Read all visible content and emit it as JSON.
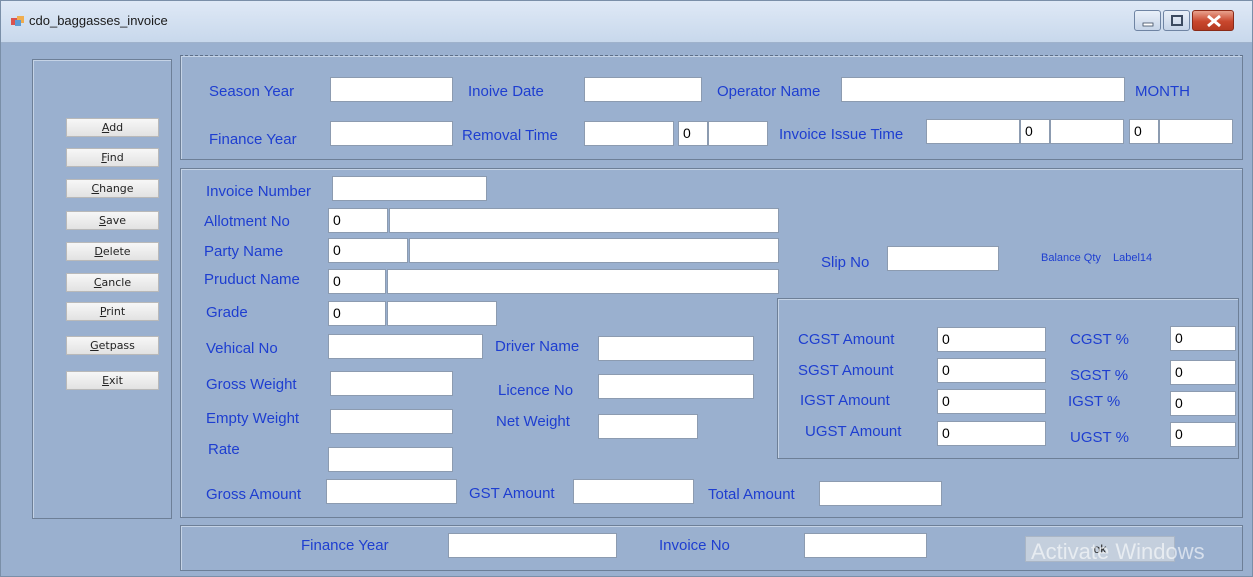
{
  "window": {
    "title": "cdo_baggasses_invoice"
  },
  "sidebar": {
    "buttons": [
      {
        "key": "add",
        "label": "Add",
        "mnemonic": "A"
      },
      {
        "key": "find",
        "label": "Find",
        "mnemonic": "F"
      },
      {
        "key": "change",
        "label": "Change",
        "mnemonic": "C"
      },
      {
        "key": "save",
        "label": "Save",
        "mnemonic": "S"
      },
      {
        "key": "delete",
        "label": "Delete",
        "mnemonic": "D"
      },
      {
        "key": "cancle",
        "label": "Cancle",
        "mnemonic": "C"
      },
      {
        "key": "print",
        "label": "Print",
        "mnemonic": "P"
      },
      {
        "key": "getpass",
        "label": "Getpass",
        "mnemonic": "G"
      },
      {
        "key": "exit",
        "label": "Exit",
        "mnemonic": "E"
      }
    ]
  },
  "header": {
    "season_year_label": "Season Year",
    "season_year_value": "",
    "invoice_date_label": "Inoive Date",
    "invoice_date_value": "",
    "operator_name_label": "Operator Name",
    "operator_name_value": "",
    "month_label": "MONTH",
    "finance_year_label": "Finance Year",
    "finance_year_value": "",
    "removal_time_label": "Removal Time",
    "removal_time_value": "",
    "removal_time_num": "0",
    "removal_time_extra": "",
    "invoice_issue_time_label": "Invoice Issue Time",
    "invoice_issue_time_value": "",
    "invoice_issue_num1": "0",
    "invoice_issue_extra1": "",
    "invoice_issue_num2": "0",
    "invoice_issue_extra2": ""
  },
  "details": {
    "invoice_number_label": "Invoice Number",
    "invoice_number_value": "",
    "allotment_no_label": "Allotment No",
    "allotment_no_code": "0",
    "allotment_no_value": "",
    "party_name_label": "Party Name",
    "party_name_code": "0",
    "party_name_value": "",
    "product_name_label": "Pruduct Name",
    "product_name_code": "0",
    "product_name_value": "",
    "grade_label": "Grade",
    "grade_code": "0",
    "grade_value": "",
    "vehical_no_label": "Vehical No",
    "vehical_no_value": "",
    "driver_name_label": "Driver Name",
    "driver_name_value": "",
    "gross_weight_label": "Gross Weight",
    "gross_weight_value": "",
    "licence_no_label": "Licence  No",
    "licence_no_value": "",
    "empty_weight_label": "Empty Weight",
    "empty_weight_value": "",
    "net_weight_label": "Net Weight",
    "net_weight_value": "",
    "rate_label": "Rate",
    "rate_value": "",
    "gross_amount_label": "Gross Amount",
    "gross_amount_value": "",
    "gst_amount_label": "GST Amount",
    "gst_amount_value": "",
    "total_amount_label": "Total Amount",
    "total_amount_value": "",
    "slip_no_label": "Slip No",
    "slip_no_value": "",
    "balance_qty_label": "Balance Qty",
    "label14": "Label14"
  },
  "gst": {
    "cgst_amount_label": "CGST Amount",
    "cgst_amount_value": "0",
    "sgst_amount_label": "SGST Amount",
    "sgst_amount_value": "0",
    "igst_amount_label": "IGST Amount",
    "igst_amount_value": "0",
    "ugst_amount_label": "UGST Amount",
    "ugst_amount_value": "0",
    "cgst_pct_label": "CGST %",
    "cgst_pct_value": "0",
    "sgst_pct_label": "SGST %",
    "sgst_pct_value": "0",
    "igst_pct_label": "IGST %",
    "igst_pct_value": "0",
    "ugst_pct_label": "UGST %",
    "ugst_pct_value": "0"
  },
  "footer": {
    "finance_year_label": "Finance Year",
    "finance_year_value": "",
    "invoice_no_label": "Invoice No",
    "invoice_no_value": "",
    "ok_label": "ok",
    "watermark": "Activate Windows"
  }
}
